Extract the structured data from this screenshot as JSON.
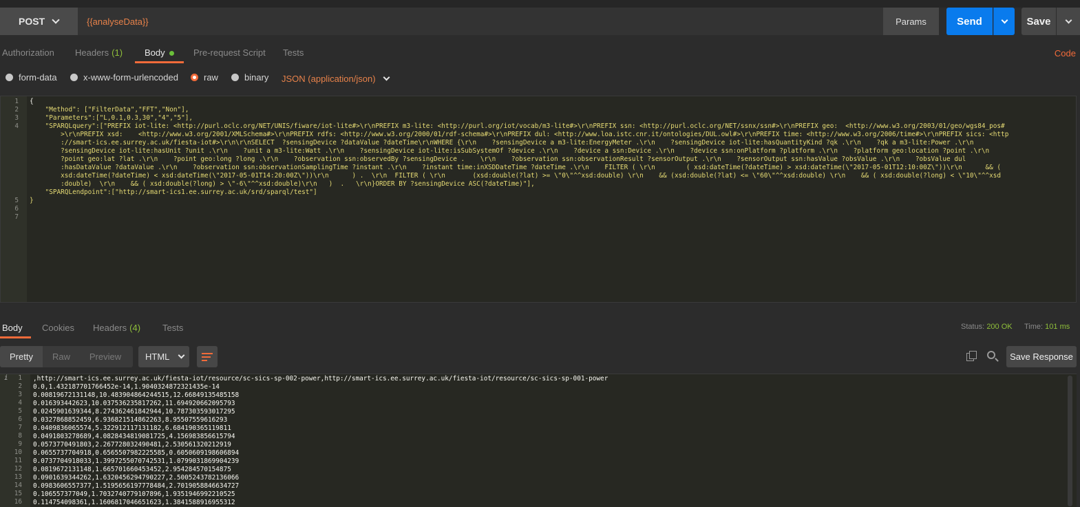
{
  "request": {
    "method": "POST",
    "url": "{{analyseData}}",
    "params_label": "Params",
    "send_label": "Send",
    "save_label": "Save"
  },
  "request_tabs": {
    "authorization": "Authorization",
    "headers": "Headers",
    "headers_count": "(1)",
    "body": "Body",
    "prerequest": "Pre-request Script",
    "tests": "Tests",
    "code": "Code"
  },
  "body_types": {
    "form_data": "form-data",
    "urlencoded": "x-www-form-urlencoded",
    "raw": "raw",
    "binary": "binary",
    "content_type": "JSON (application/json)"
  },
  "request_body": {
    "line_numbers": [
      "1",
      "2",
      "3",
      "4",
      "",
      "",
      "",
      "",
      "",
      "",
      "",
      "",
      "5",
      "6",
      "7"
    ],
    "lines": [
      "{",
      "    \"Method\": [\"FilterData\",\"FFT\",\"Non\"],",
      "    \"Parameters\":[\"L,0.1,0.3,30\",\"4\",\"5\"],",
      "    \"SPARQLquery\":[\"PREFIX iot-lite: <http://purl.oclc.org/NET/UNIS/fiware/iot-lite#>\\r\\nPREFIX m3-lite: <http://purl.org/iot/vocab/m3-lite#>\\r\\nPREFIX ssn: <http://purl.oclc.org/NET/ssnx/ssn#>\\r\\nPREFIX geo:  <http://www.w3.org/2003/01/geo/wgs84_pos#",
      "        >\\r\\nPREFIX xsd:    <http://www.w3.org/2001/XMLSchema#>\\r\\nPREFIX rdfs: <http://www.w3.org/2000/01/rdf-schema#>\\r\\nPREFIX dul: <http://www.loa.istc.cnr.it/ontologies/DUL.owl#>\\r\\nPREFIX time: <http://www.w3.org/2006/time#>\\r\\nPREFIX sics: <http",
      "        ://smart-ics.ee.surrey.ac.uk/fiesta-iot#>\\r\\n\\r\\nSELECT  ?sensingDevice ?dataValue ?dateTime\\r\\nWHERE {\\r\\n    ?sensingDevice a m3-lite:EnergyMeter .\\r\\n    ?sensingDevice iot-lite:hasQuantityKind ?qk .\\r\\n    ?qk a m3-lite:Power .\\r\\n",
      "        ?sensingDevice iot-lite:hasUnit ?unit .\\r\\n    ?unit a m3-lite:Watt .\\r\\n    ?sensingDevice iot-lite:isSubSystemOf ?device .\\r\\n    ?device a ssn:Device .\\r\\n    ?device ssn:onPlatform ?platform .\\r\\n    ?platform geo:location ?point .\\r\\n",
      "        ?point geo:lat ?lat .\\r\\n    ?point geo:long ?long .\\r\\n    ?observation ssn:observedBy ?sensingDevice .    \\r\\n    ?observation ssn:observationResult ?sensorOutput .\\r\\n    ?sensorOutput ssn:hasValue ?obsValue .\\r\\n    ?obsValue dul",
      "        :hasDataValue ?dataValue .\\r\\n    ?observation ssn:observationSamplingTime ?instant .\\r\\n    ?instant time:inXSDDateTime ?dateTime .\\r\\n    FILTER ( \\r\\n        ( xsd:dateTime(?dateTime) > xsd:dateTime(\\\"2017-05-01T12:10:00Z\\\"))\\r\\n      && (",
      "        xsd:dateTime(?dateTime) < xsd:dateTime(\\\"2017-05-01T14:20:00Z\\\"))\\r\\n      ) .  \\r\\n  FILTER ( \\r\\n       (xsd:double(?lat) >= \\\"0\\\"^^xsd:double) \\r\\n    && (xsd:double(?lat) <= \\\"60\\\"^^xsd:double) \\r\\n    && ( xsd:double(?long) < \\\"10\\\"^^xsd",
      "        :double)  \\r\\n    && ( xsd:double(?long) > \\\"-6\\\"^^xsd:double)\\r\\n   )  .   \\r\\n}ORDER BY ?sensingDevice ASC(?dateTime)\"],",
      "    \"SPARQLendpoint\":[\"http://smart-ics1.ee.surrey.ac.uk/srd/sparql/test\"]",
      "}",
      ""
    ]
  },
  "response_tabs": {
    "body": "Body",
    "cookies": "Cookies",
    "headers": "Headers",
    "headers_count": "(4)",
    "tests": "Tests",
    "status_label": "Status:",
    "status_value": "200 OK",
    "time_label": "Time:",
    "time_value": "101 ms"
  },
  "response_toolbar": {
    "pretty": "Pretty",
    "raw": "Raw",
    "preview": "Preview",
    "format": "HTML",
    "save_response": "Save Response"
  },
  "response_body": {
    "line_numbers": [
      "1",
      "2",
      "3",
      "4",
      "5",
      "6",
      "7",
      "8",
      "9",
      "10",
      "11",
      "12",
      "13",
      "14",
      "15",
      "16"
    ],
    "info_marker": "i",
    "lines": [
      ",http://smart-ics.ee.surrey.ac.uk/fiesta-iot/resource/sc-sics-sp-002-power,http://smart-ics.ee.surrey.ac.uk/fiesta-iot/resource/sc-sics-sp-001-power",
      "0.0,1.432187701766452e-14,1.9040324872321435e-14",
      "0.00819672131148,10.483904864244515,12.66849135485158",
      "0.016393442623,10.037536235817262,11.694920662095793",
      "0.0245901639344,8.274362461842944,10.787303593017295",
      "0.0327868852459,6.936821514862263,8.95507559616293",
      "0.0409836065574,5.322912117131182,6.684190365119811",
      "0.0491803278689,4.0828434819081725,4.156983856615794",
      "0.0573770491803,2.267728032490481,2.530561320212919",
      "0.0655737704918,0.6565507982225585,0.6050609198606894",
      "0.0737704918033,1.3997255070742531,1.0799031869904239",
      "0.0819672131148,1.665701660453452,2.954284570154875",
      "0.0901639344262,1.6320456294790227,2.5005243782136066",
      "0.0983606557377,1.5195656197778484,2.7019058846634727",
      "0.106557377049,1.7032740779107896,1.9351946992210525",
      "0.114754098361,1.1606817046651623,1.3841588916955312"
    ]
  },
  "colors": {
    "accent": "#f26b3a",
    "send": "#097bed",
    "ok": "#8fbf3a",
    "url_text": "#e8824a"
  }
}
